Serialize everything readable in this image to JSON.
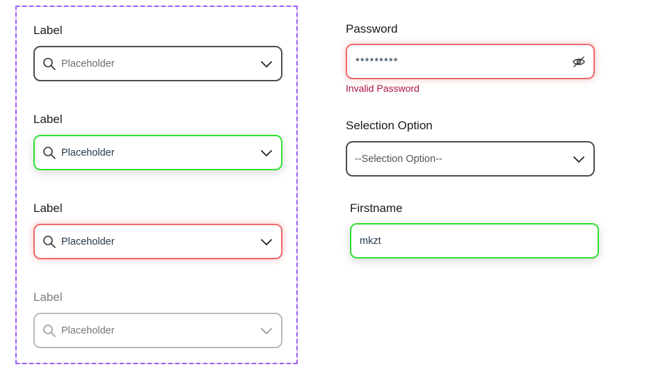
{
  "dropdown_variants": [
    {
      "label": "Label",
      "placeholder": "Placeholder",
      "state": "default"
    },
    {
      "label": "Label",
      "placeholder": "Placeholder",
      "state": "success"
    },
    {
      "label": "Label",
      "placeholder": "Placeholder",
      "state": "error"
    },
    {
      "label": "Label",
      "placeholder": "Placeholder",
      "state": "disabled"
    }
  ],
  "password": {
    "label": "Password",
    "value": "*********",
    "error_message": "Invalid Password",
    "state": "error",
    "icon": "eye-off-icon"
  },
  "selection": {
    "label": "Selection Option",
    "value": "--Selection Option--",
    "icon": "chevron-down-icon"
  },
  "firstname": {
    "label": "Firstname",
    "value": "mkzt",
    "state": "success"
  },
  "colors": {
    "frame": "#9b5cf5",
    "success": "#2fe02f",
    "error": "#ec6b6b",
    "error_text": "#b0123e",
    "default_border": "#4d4d4d",
    "disabled_border": "#b9b9b9"
  }
}
